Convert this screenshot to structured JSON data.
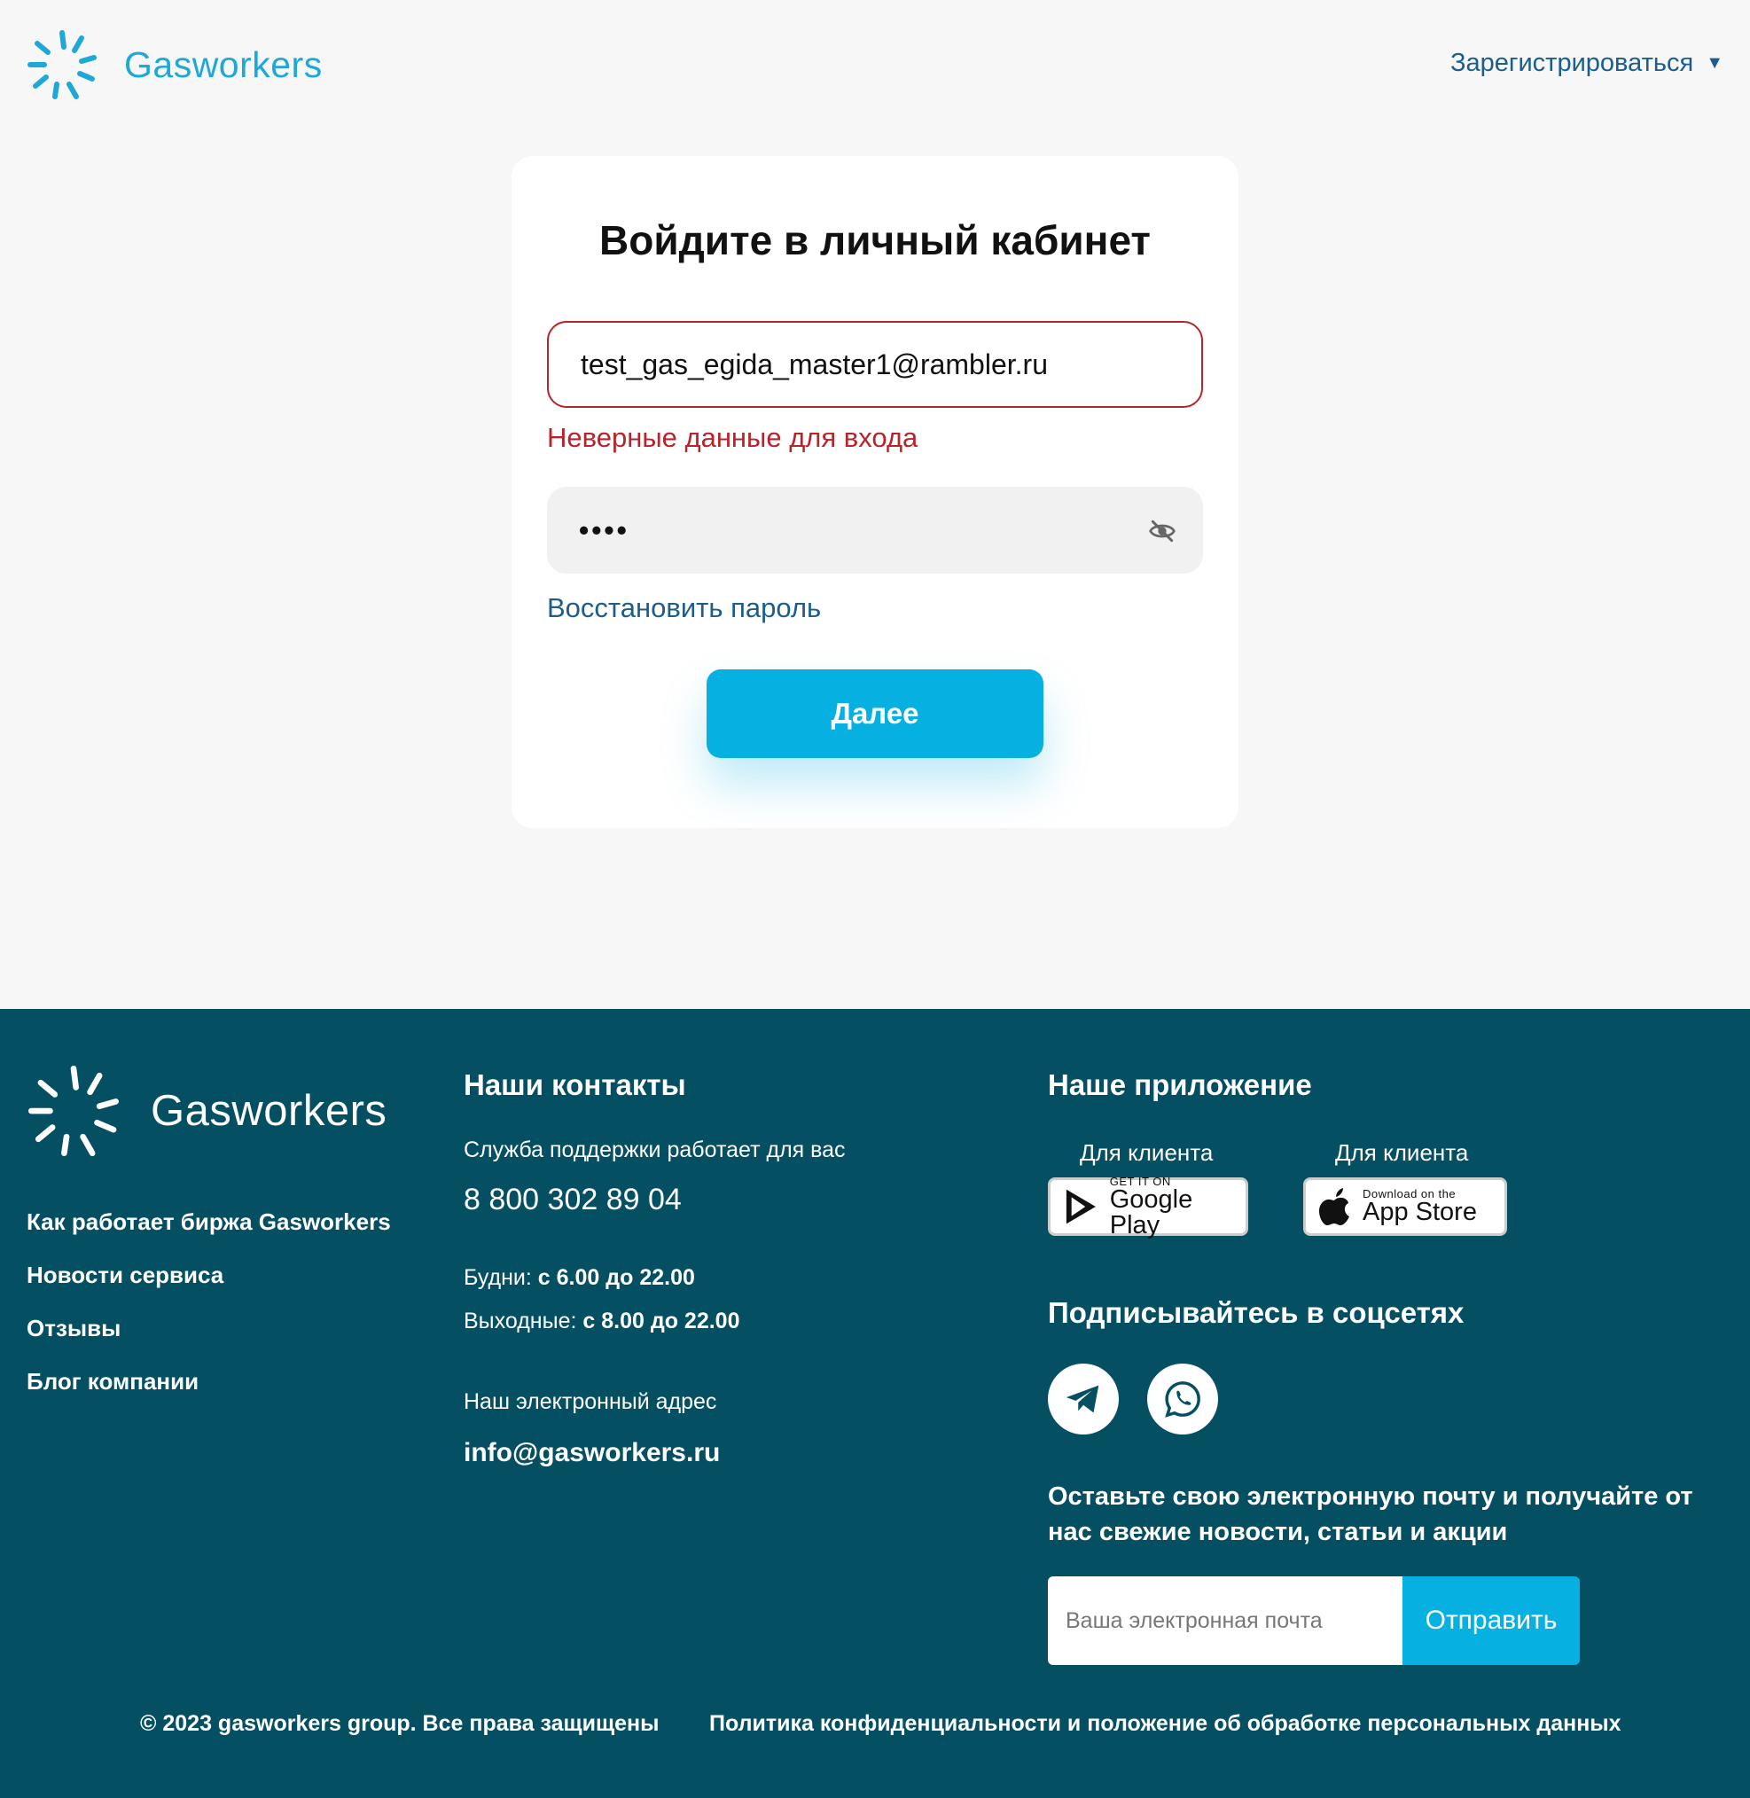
{
  "header": {
    "logo_text": "Gasworkers",
    "register_label": "Зарегистрироваться"
  },
  "login": {
    "title": "Войдите в личный кабинет",
    "email_value": "test_gas_egida_master1@rambler.ru",
    "error_text": "Неверные данные для входа",
    "password_masked": "••••",
    "restore_link": "Восстановить пароль",
    "submit_label": "Далее"
  },
  "footer": {
    "logo_text": "Gasworkers",
    "links": [
      "Как работает биржа Gasworkers",
      "Новости сервиса",
      "Отзывы",
      "Блог компании"
    ],
    "contacts": {
      "title": "Наши контакты",
      "support": "Служба поддержки работает для вас",
      "phone": "8 800 302 89 04",
      "weekdays_label": "Будни:",
      "weekdays_value": "с 6.00 до 22.00",
      "weekend_label": "Выходные:",
      "weekend_value": "с 8.00 до 22.00",
      "email_label": "Наш электронный адрес",
      "email": "info@gasworkers.ru"
    },
    "app": {
      "title": "Наше приложение",
      "google_label": "Для клиента",
      "google_small": "GET IT ON",
      "google_big": "Google Play",
      "apple_label": "Для клиента",
      "apple_small": "Download on the",
      "apple_big": "App Store"
    },
    "social": {
      "title": "Подписывайтесь в соцсетях",
      "icons": [
        "telegram-icon",
        "whatsapp-icon"
      ]
    },
    "subscribe": {
      "text": "Оставьте свою электронную почту и получайте от нас свежие новости, статьи и акции",
      "placeholder": "Ваша электронная почта",
      "button": "Отправить"
    },
    "copyright": "© 2023 gasworkers group. Все права защищены",
    "policy": "Политика конфиденциальности и положение об обработке персональных данных"
  },
  "colors": {
    "accent": "#06b1e2",
    "logo_blue": "#1ea8d8",
    "link_blue": "#1b5e8c",
    "error_red": "#b8242a",
    "footer_bg": "#054f63",
    "page_bg": "#f7f7f7"
  }
}
